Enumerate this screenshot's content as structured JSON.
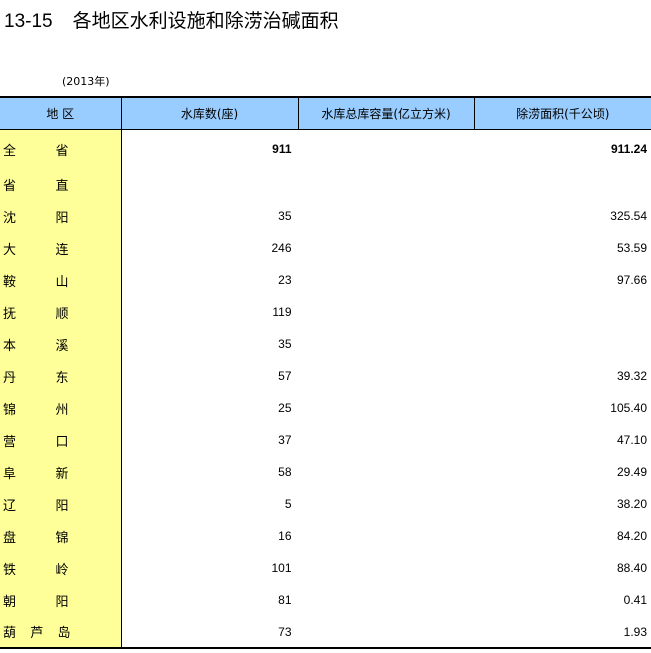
{
  "title": {
    "number": "13-15",
    "text": "各地区水利设施和除涝治碱面积"
  },
  "year_note": "(2013年)",
  "headers": [
    "地 区",
    "水库数(座)",
    "水库总库容量(亿立方米)",
    "除涝面积(千公顷)"
  ],
  "rows": [
    {
      "region": [
        "全",
        "省"
      ],
      "reservoirs": "911",
      "capacity": "",
      "drainage": "911.24",
      "bold": true
    },
    {
      "region": [
        "省",
        "直"
      ],
      "reservoirs": "",
      "capacity": "",
      "drainage": ""
    },
    {
      "region": [
        "沈",
        "阳"
      ],
      "reservoirs": "35",
      "capacity": "",
      "drainage": "325.54"
    },
    {
      "region": [
        "大",
        "连"
      ],
      "reservoirs": "246",
      "capacity": "",
      "drainage": "53.59"
    },
    {
      "region": [
        "鞍",
        "山"
      ],
      "reservoirs": "23",
      "capacity": "",
      "drainage": "97.66"
    },
    {
      "region": [
        "抚",
        "顺"
      ],
      "reservoirs": "119",
      "capacity": "",
      "drainage": ""
    },
    {
      "region": [
        "本",
        "溪"
      ],
      "reservoirs": "35",
      "capacity": "",
      "drainage": ""
    },
    {
      "region": [
        "丹",
        "东"
      ],
      "reservoirs": "57",
      "capacity": "",
      "drainage": "39.32"
    },
    {
      "region": [
        "锦",
        "州"
      ],
      "reservoirs": "25",
      "capacity": "",
      "drainage": "105.40"
    },
    {
      "region": [
        "营",
        "口"
      ],
      "reservoirs": "37",
      "capacity": "",
      "drainage": "47.10"
    },
    {
      "region": [
        "阜",
        "新"
      ],
      "reservoirs": "58",
      "capacity": "",
      "drainage": "29.49"
    },
    {
      "region": [
        "辽",
        "阳"
      ],
      "reservoirs": "5",
      "capacity": "",
      "drainage": "38.20"
    },
    {
      "region": [
        "盘",
        "锦"
      ],
      "reservoirs": "16",
      "capacity": "",
      "drainage": "84.20"
    },
    {
      "region": [
        "铁",
        "岭"
      ],
      "reservoirs": "101",
      "capacity": "",
      "drainage": "88.40"
    },
    {
      "region": [
        "朝",
        "阳"
      ],
      "reservoirs": "81",
      "capacity": "",
      "drainage": "0.41"
    },
    {
      "region": [
        "葫",
        "芦",
        "岛"
      ],
      "reservoirs": "73",
      "capacity": "",
      "drainage": "1.93"
    }
  ]
}
